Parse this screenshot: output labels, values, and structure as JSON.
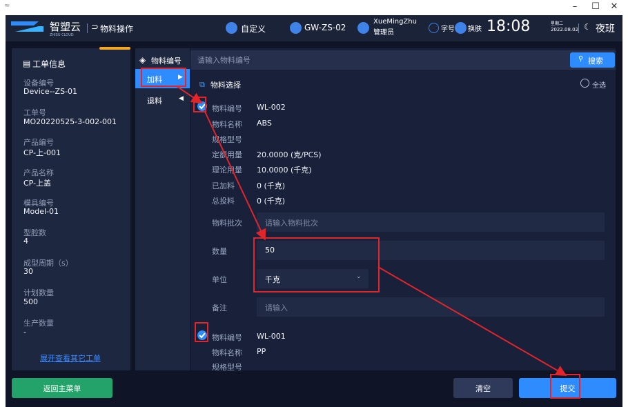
{
  "window": {
    "minimize": "–",
    "maximize": "☐",
    "close": "✕"
  },
  "header": {
    "brand": "智塑云",
    "brand_sub": "ZHISU CLOUD",
    "page_title": "物料操作",
    "custom": "自定义",
    "station": "GW-ZS-02",
    "user_name": "XueMingZhu",
    "user_role": "管理员",
    "font_size": "字号",
    "skin": "换肤",
    "time": "18:08",
    "weekday": "星期二",
    "date": "2022.08.02",
    "shift": "夜班"
  },
  "workorder": {
    "title": "工单信息",
    "fields": [
      {
        "label": "设备编号",
        "value": "Device--ZS-01"
      },
      {
        "label": "工单号",
        "value": "MO20220525-3-002-001"
      },
      {
        "label": "产品编号",
        "value": "CP-上-001"
      },
      {
        "label": "产品名称",
        "value": "CP-上盖"
      },
      {
        "label": "模具编号",
        "value": "Model-01"
      },
      {
        "label": "型腔数",
        "value": "4"
      },
      {
        "label": "成型周期（s）",
        "value": "30"
      },
      {
        "label": "计划数量",
        "value": "500"
      },
      {
        "label": "生产数量",
        "value": "-"
      }
    ],
    "expand_link": "展开查看其它工单"
  },
  "tabs": {
    "header": "物料编号",
    "items": [
      "加料",
      "退料"
    ]
  },
  "search": {
    "placeholder": "请输入物料编号",
    "button": "搜索"
  },
  "selection": {
    "title": "物料选择",
    "select_all": "全选"
  },
  "materials": [
    {
      "fields": [
        {
          "label": "物料编号",
          "value": "WL-002"
        },
        {
          "label": "物料名称",
          "value": "ABS"
        },
        {
          "label": "规格型号",
          "value": ""
        },
        {
          "label": "定额用量",
          "value": "20.0000 (克/PCS)"
        },
        {
          "label": "理论用量",
          "value": "10.0000 (千克)"
        },
        {
          "label": "已加料",
          "value": "0 (千克)"
        },
        {
          "label": "总投料",
          "value": "0 (千克)"
        }
      ],
      "batch_label": "物料批次",
      "batch_placeholder": "请输入物料批次",
      "qty_label": "数量",
      "qty_value": "50",
      "unit_label": "单位",
      "unit_value": "千克",
      "remark_label": "备注",
      "remark_placeholder": "请输入"
    },
    {
      "fields": [
        {
          "label": "物料编号",
          "value": "WL-001"
        },
        {
          "label": "物料名称",
          "value": "PP"
        },
        {
          "label": "规格型号",
          "value": ""
        }
      ]
    }
  ],
  "footer": {
    "back": "返回主菜单",
    "clear": "清空",
    "submit": "提交"
  },
  "colors": {
    "accent": "#2f8cff",
    "annotation": "#e1252b",
    "bg": "#0f1526"
  }
}
